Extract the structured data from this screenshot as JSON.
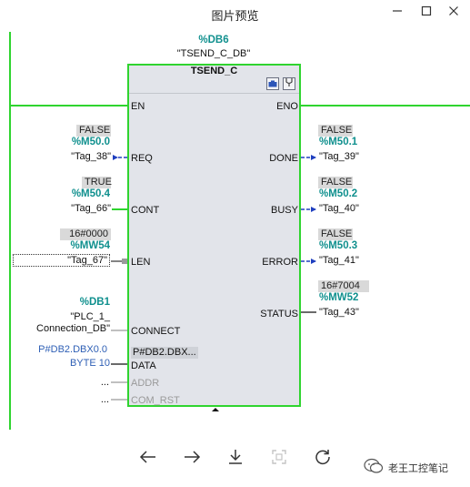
{
  "window": {
    "title": "图片预览"
  },
  "block": {
    "instance_address": "%DB6",
    "instance_name": "\"TSEND_C_DB\"",
    "type": "TSEND_C",
    "pins_left": [
      "EN",
      "REQ",
      "CONT",
      "LEN",
      "CONNECT",
      "DATA",
      "ADDR",
      "COM_RST"
    ],
    "pins_right": [
      "ENO",
      "DONE",
      "BUSY",
      "ERROR",
      "STATUS"
    ],
    "data_value": "P#DB2.DBX..."
  },
  "inputs": {
    "req": {
      "value": "FALSE",
      "address": "%M50.0",
      "tag": "\"Tag_38\""
    },
    "cont": {
      "value": "TRUE",
      "address": "%M50.4",
      "tag": "\"Tag_66\""
    },
    "len": {
      "value": "16#0000",
      "address": "%MW54",
      "tag": "\"Tag_67\""
    },
    "connect": {
      "address": "%DB1",
      "tag_line1": "\"PLC_1_",
      "tag_line2": "Connection_DB\""
    },
    "data": {
      "line1": "P#DB2.DBX0.0",
      "line2": "BYTE 10"
    },
    "addr": {
      "placeholder": "..."
    },
    "com_rst": {
      "placeholder": "..."
    }
  },
  "outputs": {
    "done": {
      "value": "FALSE",
      "address": "%M50.1",
      "tag": "\"Tag_39\""
    },
    "busy": {
      "value": "FALSE",
      "address": "%M50.2",
      "tag": "\"Tag_40\""
    },
    "error": {
      "value": "FALSE",
      "address": "%M50.3",
      "tag": "\"Tag_41\""
    },
    "status": {
      "value": "16#7004",
      "address": "%MW52",
      "tag": "\"Tag_43\""
    }
  },
  "toolbar": {
    "icons": [
      "arrow-left-icon",
      "arrow-right-icon",
      "download-icon",
      "crop-icon",
      "rotate-icon"
    ]
  },
  "watermark": {
    "text": "老王工控笔记"
  },
  "colors": {
    "power_flow": "#2fd42f",
    "address": "#10908e",
    "wire": "#1f3fbf",
    "constant": "#2e5fb5"
  }
}
